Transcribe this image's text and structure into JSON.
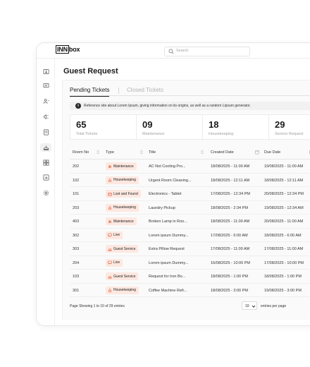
{
  "app": {
    "logo_prefix": "INN",
    "logo_suffix": "box"
  },
  "search": {
    "placeholder": "Search"
  },
  "page": {
    "title": "Guest Request"
  },
  "tabs": [
    {
      "label": "Pending Tickets",
      "active": true
    },
    {
      "label": "Closed Tickets",
      "active": false
    }
  ],
  "notice": {
    "text": "Reference site about Lorem Ipsum, giving information on its origins, as well as a random Lipsum generator."
  },
  "stats": [
    {
      "value": "65",
      "label": "Total Tickets"
    },
    {
      "value": "09",
      "label": "Maintenance"
    },
    {
      "value": "18",
      "label": "Housekeeping"
    },
    {
      "value": "29",
      "label": "Service Request"
    }
  ],
  "table": {
    "headers": [
      "Room No",
      "Type",
      "Title",
      "Created Date",
      "Due Date"
    ],
    "rows": [
      {
        "room": "202",
        "type": "Maintenance",
        "icon": "wrench-icon",
        "title": "AC Not Cooling Pro...",
        "created": "18/08/2025 - 11:00 AM",
        "due": "19/08/2025 - 11:00 AM"
      },
      {
        "room": "102",
        "type": "Housekeeping",
        "icon": "broom-icon",
        "title": "Urgent Room Cleaning...",
        "created": "18/08/2025 - 12:11 AM",
        "due": "18/08/2025 - 12:11 AM"
      },
      {
        "room": "101",
        "type": "Lost and Found",
        "icon": "box-icon",
        "title": "Electronics - Tablet",
        "created": "17/08/2025 - 12:34 PM",
        "due": "20/08/2025 - 12:34 PM"
      },
      {
        "room": "203",
        "type": "Housekeeping",
        "icon": "broom-icon",
        "title": "Laundry Pickup",
        "created": "18/08/2025 - 2:34 PM",
        "due": "19/08/2025 - 12:34 AM"
      },
      {
        "room": "403",
        "type": "Maintenance",
        "icon": "wrench-icon",
        "title": "Broken Lamp in Roo...",
        "created": "18/08/2025 - 11:00 AM",
        "due": "20/08/2025 - 11:00 AM"
      },
      {
        "room": "302",
        "type": "Live",
        "icon": "chat-icon",
        "title": "Lorem ipsum Dummy...",
        "created": "17/08/2025 - 6:00 AM",
        "due": "18/08/2025 - 6:00 AM"
      },
      {
        "room": "303",
        "type": "Guest Service",
        "icon": "bell-icon",
        "title": "Extra Pillow Request",
        "created": "17/08/2025 - 11:00 AM",
        "due": "17/08/2025 - 11:00 AM"
      },
      {
        "room": "204",
        "type": "Live",
        "icon": "chat-icon",
        "title": "Lorem ipsum Dummy...",
        "created": "16/08/2025 - 10:00 PM",
        "due": "17/08/2025 - 10:00 PM"
      },
      {
        "room": "103",
        "type": "Guest Service",
        "icon": "bell-icon",
        "title": "Request for Iron Bo...",
        "created": "18/08/2025 - 1:00 PM",
        "due": "18/08/2025 - 1:00 PM"
      },
      {
        "room": "301",
        "type": "Housekeeping",
        "icon": "broom-icon",
        "title": "Coffee Machine Refi...",
        "created": "18/08/2025 - 3:00 PM",
        "due": "19/08/2025 - 3:00 PM"
      }
    ]
  },
  "footer": {
    "showing": "Page Showing 1 to 10 of 29 entries",
    "per_page": "10",
    "per_page_suffix": "entries per page"
  },
  "colors": {
    "badge_bg": "#fde8e1",
    "badge_icon": "#d9512c",
    "active_nav": "#f0f0f0"
  }
}
